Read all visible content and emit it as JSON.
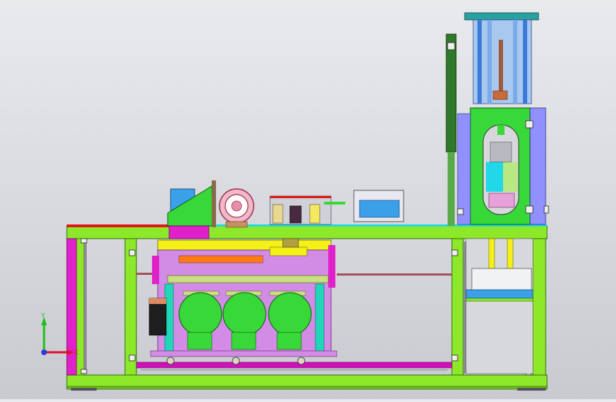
{
  "viewport": {
    "background_top": "#e9eaed",
    "background_bottom": "#c9cad0"
  },
  "triad": {
    "x_label": "X",
    "y_label": "Y",
    "x_color": "#e0102a",
    "y_color": "#1cc01c",
    "origin_color": "#2a3ad8"
  },
  "colors": {
    "frame_green": "#8ee82a",
    "frame_dark": "#2f6a10",
    "magenta": "#e020c8",
    "lavender": "#d28ce6",
    "yellow": "#f4f018",
    "orange": "#ff7a18",
    "cyan": "#20d8d8",
    "blue_panel": "#9090ff",
    "steel_blue": "#3aa0e8",
    "cylinder_green": "#38d838",
    "red": "#e01818",
    "grey_rail": "#8a8a90"
  }
}
